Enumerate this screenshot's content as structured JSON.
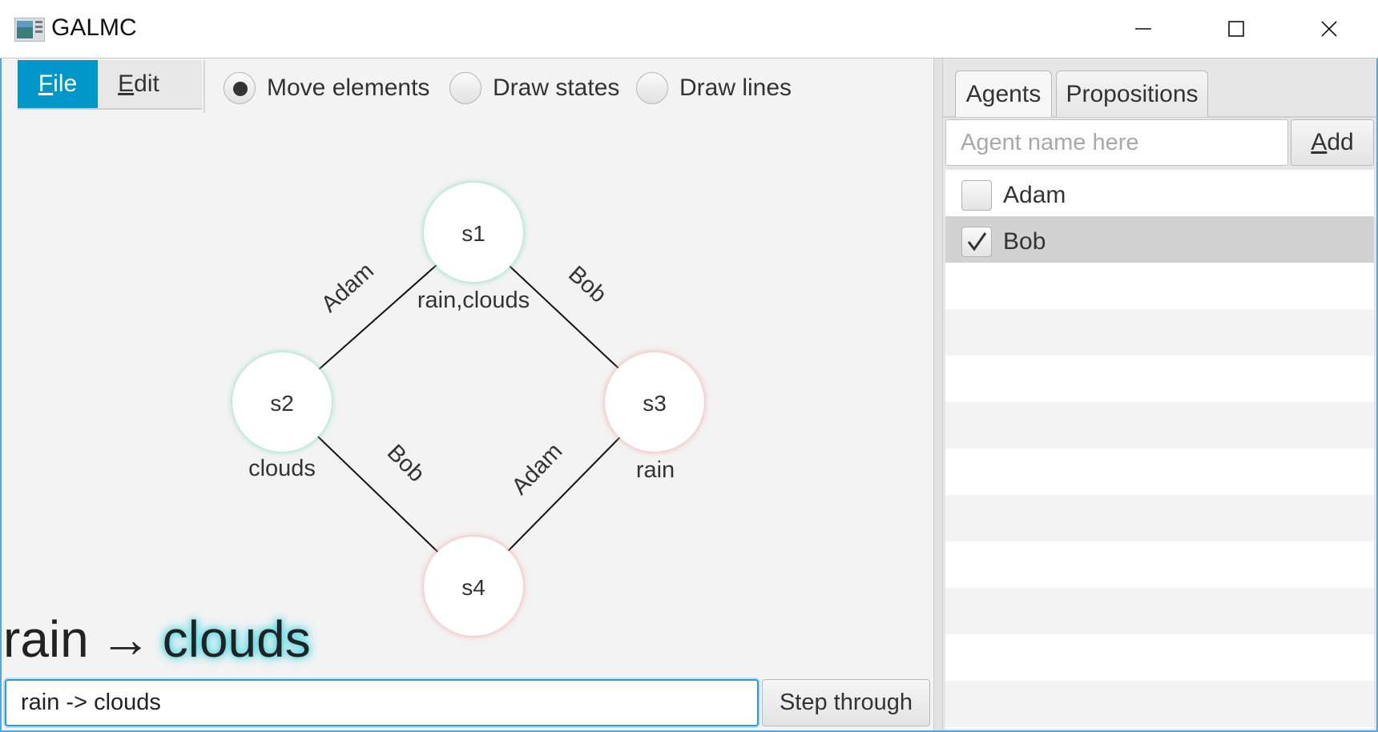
{
  "window": {
    "title": "GALMC",
    "controls": [
      "minimize",
      "maximize",
      "close"
    ]
  },
  "menu": {
    "file": {
      "label_mnemonic": "F",
      "label_rest": "ile"
    },
    "edit": {
      "label_mnemonic": "E",
      "label_rest": "dit"
    }
  },
  "modes": {
    "move": "Move elements",
    "states": "Draw states",
    "lines": "Draw lines",
    "selected": "move"
  },
  "graph": {
    "states": [
      {
        "name": "s1",
        "props": "rain,clouds",
        "status": "true"
      },
      {
        "name": "s2",
        "props": "clouds",
        "status": "true"
      },
      {
        "name": "s3",
        "props": "rain",
        "status": "false"
      },
      {
        "name": "s4",
        "props": "",
        "status": "false"
      }
    ],
    "edges": [
      {
        "from": "s1",
        "to": "s2",
        "label": "Adam"
      },
      {
        "from": "s1",
        "to": "s3",
        "label": "Bob"
      },
      {
        "from": "s2",
        "to": "s4",
        "label": "Bob"
      },
      {
        "from": "s3",
        "to": "s4",
        "label": "Adam"
      }
    ],
    "colors": {
      "true_glow": "#7fdcae",
      "false_glow": "#f2a3a3"
    }
  },
  "formula": {
    "left": "rain",
    "arrow": "→",
    "right": "clouds",
    "input_value": "rain -> clouds",
    "step_button": "Step through"
  },
  "sidebar": {
    "tabs": [
      "Agents",
      "Propositions"
    ],
    "active_tab": "Agents",
    "agent_placeholder": "Agent name here",
    "add_mnemonic": "A",
    "add_rest": "dd",
    "agents": [
      {
        "name": "Adam",
        "checked": false
      },
      {
        "name": "Bob",
        "checked": true,
        "selected": true
      }
    ]
  },
  "theme": {
    "accent": "#0096c9",
    "focus": "#2b9ad6"
  }
}
